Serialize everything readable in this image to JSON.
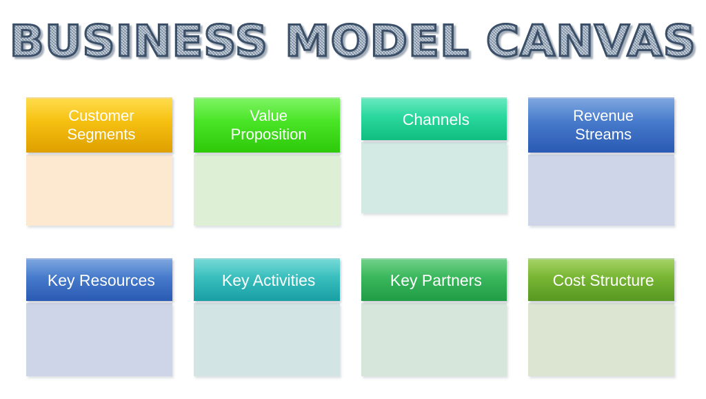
{
  "title": "BUSINESS MODEL CANVAS",
  "title_style": {
    "outline_color": "#3b5068",
    "fill_color": "#c9d4e0",
    "shadow_color": "#5a697d"
  },
  "background_color": "#ffffff",
  "rows": [
    {
      "name": "top-row",
      "blocks": [
        {
          "label": "Customer\nSegments",
          "label_lines": [
            "Customer",
            "Segments"
          ],
          "header_color_top": "#ffd21e",
          "header_color_bottom": "#eaa800",
          "body_color": "#fde8d0",
          "text_color": "#ffffff"
        },
        {
          "label": "Value\nProposition",
          "label_lines": [
            "Value",
            "Proposition"
          ],
          "header_color_top": "#5cf03a",
          "header_color_bottom": "#2fd40a",
          "body_color": "#ddf0d5",
          "text_color": "#ffffff"
        },
        {
          "label": "Channels",
          "label_lines": [
            "Channels"
          ],
          "header_color_top": "#3fe3ae",
          "header_color_bottom": "#10c887",
          "body_color": "#d3e9e4",
          "text_color": "#ffffff"
        },
        {
          "label": "Revenue\nStreams",
          "label_lines": [
            "Revenue",
            "Streams"
          ],
          "header_color_top": "#5b8fd6",
          "header_color_bottom": "#2c5fbd",
          "body_color": "#ced5e8",
          "text_color": "#ffffff"
        }
      ]
    },
    {
      "name": "bottom-row",
      "blocks": [
        {
          "label": "Key Resources",
          "label_lines": [
            "Key Resources"
          ],
          "header_color_top": "#5b8fd6",
          "header_color_bottom": "#2c5fbd",
          "body_color": "#ced5e8",
          "text_color": "#ffffff"
        },
        {
          "label": "Key Activities",
          "label_lines": [
            "Key Activities"
          ],
          "header_color_top": "#51cfcb",
          "header_color_bottom": "#1aa8ac",
          "body_color": "#d3e4e4",
          "text_color": "#ffffff"
        },
        {
          "label": "Key Partners",
          "label_lines": [
            "Key Partners"
          ],
          "header_color_top": "#4cc46a",
          "header_color_bottom": "#22a54a",
          "body_color": "#d6e6da",
          "text_color": "#ffffff"
        },
        {
          "label": "Cost Structure",
          "label_lines": [
            "Cost Structure"
          ],
          "header_color_top": "#8dc63f",
          "header_color_bottom": "#5ca024",
          "body_color": "#dce4d2",
          "text_color": "#ffffff"
        }
      ]
    }
  ]
}
